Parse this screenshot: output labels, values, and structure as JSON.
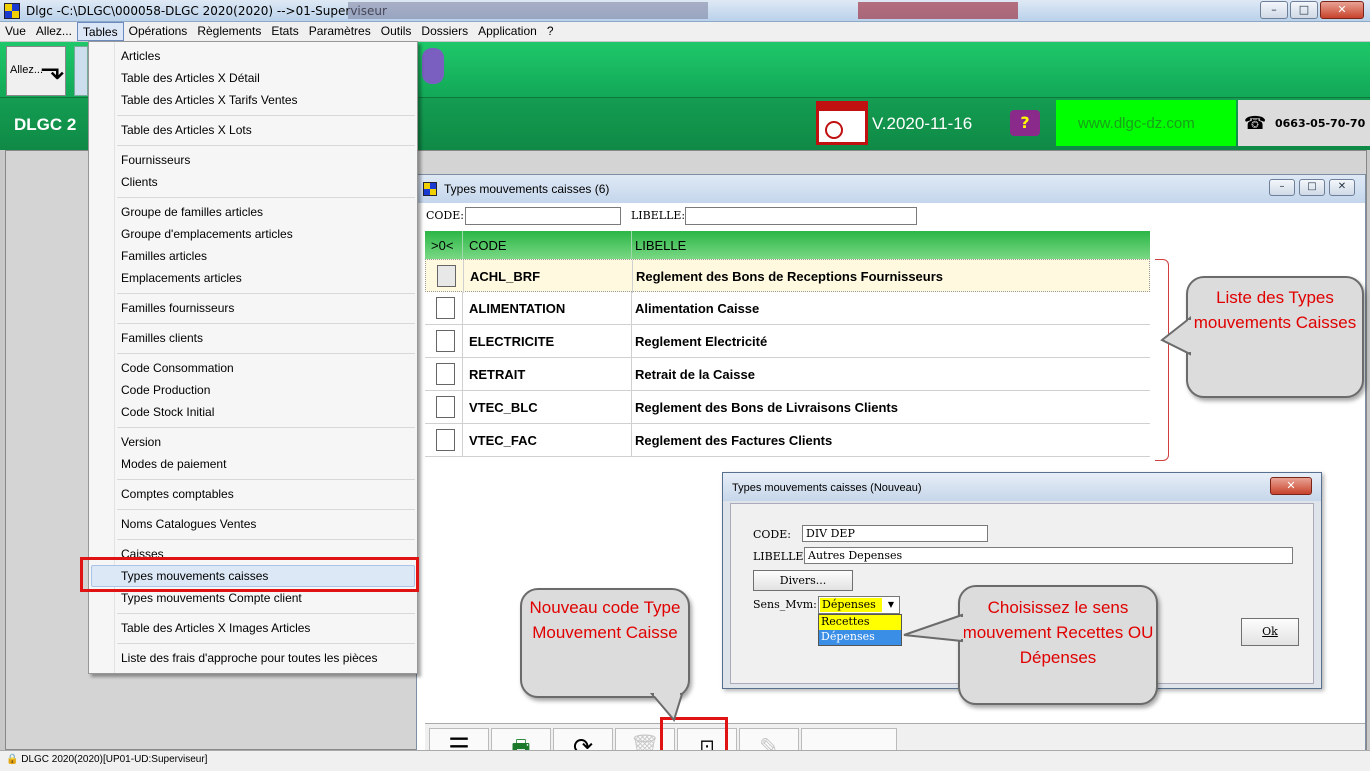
{
  "window": {
    "title": "Dlgc -C:\\DLGC\\000058-DLGC 2020(2020) -->01-Superviseur",
    "buttons": {
      "minimize": "–",
      "maximize": "□",
      "close": "✕"
    }
  },
  "menubar": {
    "items": [
      "Vue",
      "Allez...",
      "Tables",
      "Opérations",
      "Règlements",
      "Etats",
      "Paramètres",
      "Outils",
      "Dossiers",
      "Application",
      "?"
    ],
    "active": "Tables"
  },
  "toolbar": {
    "allez_label": "Allez..."
  },
  "infobar": {
    "brand": "DLGC 2",
    "version": "V.2020-11-16",
    "website": "www.dlgc-dz.com",
    "phone": "0663-05-70-70"
  },
  "tables_menu": {
    "items": [
      "Articles",
      "Table des Articles X Détail",
      "Table des Articles X Tarifs Ventes",
      "Table des Articles X Lots",
      "Fournisseurs",
      "Clients",
      "Groupe de familles articles",
      "Groupe d'emplacements articles",
      "Familles articles",
      "Emplacements articles",
      "Familles fournisseurs",
      "Familles clients",
      "Code Consommation",
      "Code Production",
      "Code Stock Initial",
      "Version",
      "Modes de paiement",
      "Comptes comptables",
      "Noms Catalogues Ventes",
      "Caisses",
      "Types mouvements caisses",
      "Types mouvements Compte client",
      "Table des Articles X Images Articles",
      "Liste des frais d'approche pour toutes les pièces"
    ],
    "highlighted": "Types mouvements caisses"
  },
  "child_window": {
    "title": "Types mouvements caisses (6)",
    "filter": {
      "code_label": "CODE:",
      "libelle_label": "LIBELLE:",
      "code_value": "",
      "libelle_value": ""
    },
    "grid": {
      "columns": [
        ">0<",
        "CODE",
        "LIBELLE"
      ],
      "rows": [
        {
          "code": "ACHL_BRF",
          "libelle": "Reglement des Bons de Receptions Fournisseurs"
        },
        {
          "code": "ALIMENTATION",
          "libelle": "Alimentation Caisse"
        },
        {
          "code": "ELECTRICITE",
          "libelle": "Reglement Electricité"
        },
        {
          "code": "RETRAIT",
          "libelle": "Retrait de la Caisse"
        },
        {
          "code": "VTEC_BLC",
          "libelle": "Reglement des Bons de Livraisons Clients"
        },
        {
          "code": "VTEC_FAC",
          "libelle": "Reglement des Factures Clients"
        }
      ]
    },
    "bottom_toolbar": [
      "menu-icon",
      "export-xls-icon",
      "refresh-icon",
      "delete-icon",
      "new-code-icon",
      "edit-icon"
    ]
  },
  "dialog": {
    "title": "Types mouvements caisses  (Nouveau)",
    "close": "✕",
    "code_label": "CODE:",
    "code_value": "DIV DEP",
    "libelle_label": "LIBELLE:",
    "libelle_value": "Autres Depenses",
    "divers_label": "Divers...",
    "sens_label": "Sens_Mvm:",
    "sens_value": "Dépenses",
    "sens_options": [
      "Recettes",
      "Dépenses"
    ],
    "ok_label": "Ok"
  },
  "callouts": {
    "list": "Liste des Types mouvements Caisses",
    "nouveau": "Nouveau code Type Mouvement Caisse",
    "sens": "Choisissez le sens mouvement Recettes OU Dépenses"
  },
  "statusbar": {
    "text": "DLGC 2020(2020)[UP01-UD:Superviseur]"
  },
  "colors": {
    "toolbar_green": "#12a857",
    "highlight_red": "#e11212",
    "callout_text": "#e00000",
    "site_green": "#00ff00",
    "select_yellow": "#ffff00"
  }
}
